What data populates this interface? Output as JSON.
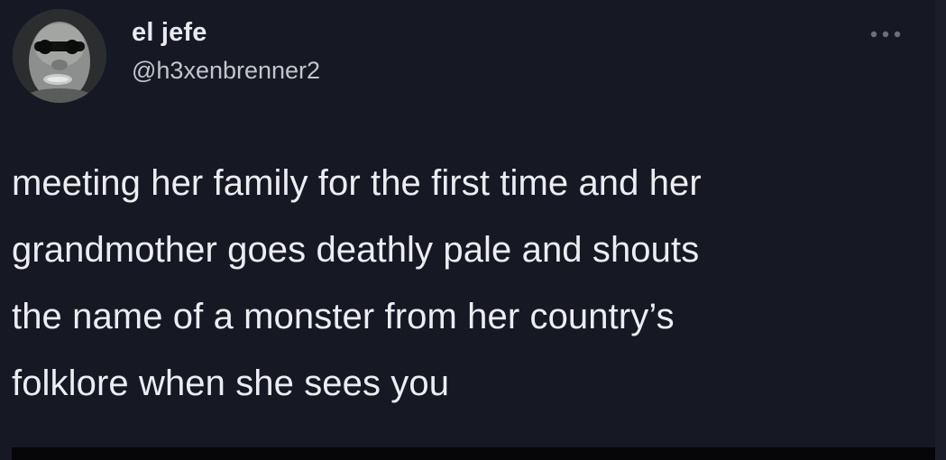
{
  "tweet": {
    "author": {
      "display_name": "el jefe",
      "handle": "@h3xenbrenner2",
      "avatar_icon": "avatar-photo"
    },
    "more_icon": "more-options-icon",
    "text_lines": [
      "meeting her family for the first time and her",
      "grandmother goes deathly pale and shouts",
      "the name of a monster from her country’s",
      "folklore when she sees you"
    ]
  },
  "colors": {
    "background": "#161824",
    "text": "#ecedf1",
    "secondary_text": "#c3c5cc"
  }
}
